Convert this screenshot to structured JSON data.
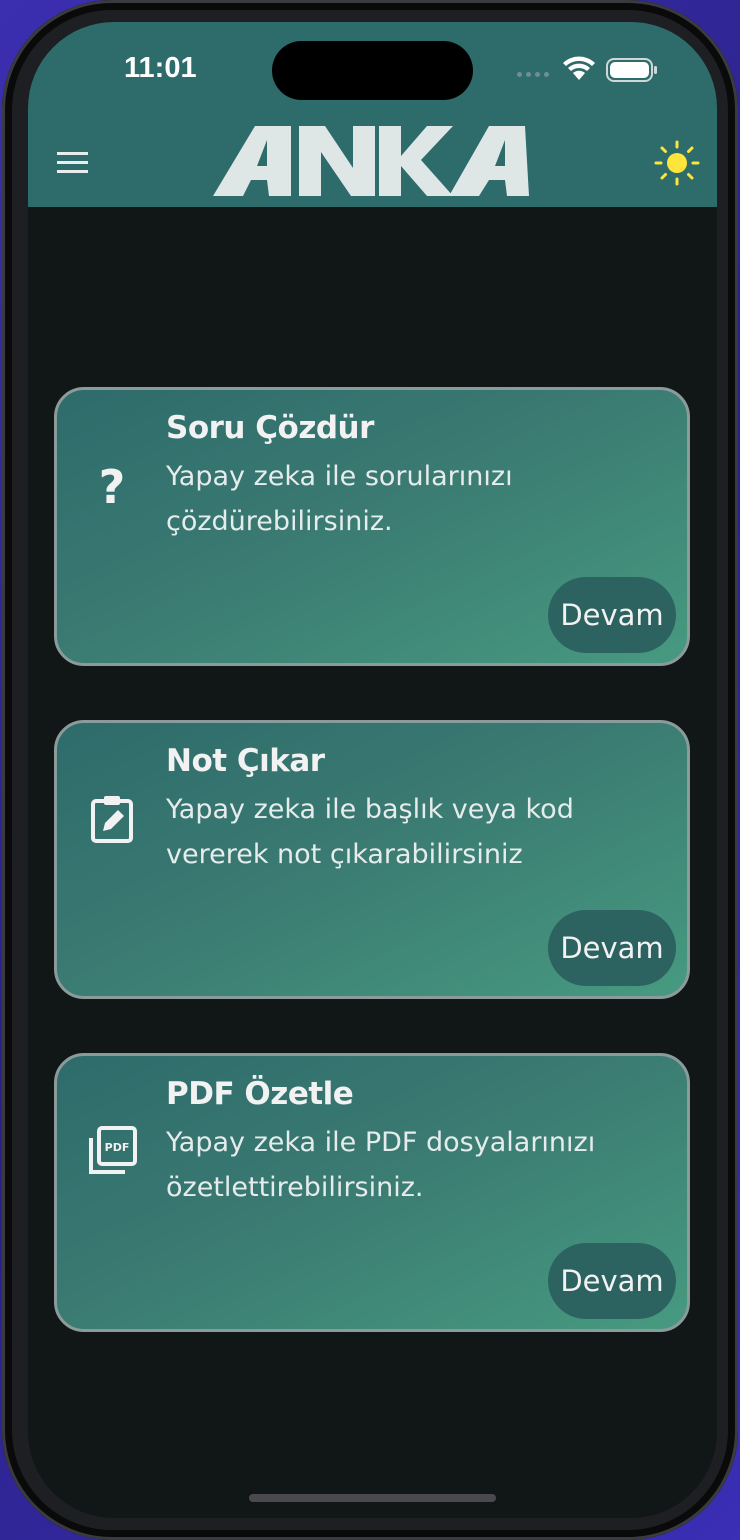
{
  "status_bar": {
    "time": "11:01"
  },
  "header": {
    "logo_text": "ANKA",
    "menu_icon": "hamburger-menu-icon",
    "theme_icon": "sun-icon",
    "colors": {
      "header_bg": "#2e6b6b",
      "logo": "#dfe6e6",
      "sun": "#ffe53b"
    }
  },
  "cards": [
    {
      "icon": "question-mark-icon",
      "icon_glyph": "?",
      "title": "Soru Çözdür",
      "description": "Yapay zeka ile sorularınızı çözdürebilirsiniz.",
      "button_label": "Devam"
    },
    {
      "icon": "clipboard-edit-icon",
      "title": "Not Çıkar",
      "description": "Yapay zeka ile başlık veya kod vererek not çıkarabilirsiniz",
      "button_label": "Devam"
    },
    {
      "icon": "pdf-stack-icon",
      "icon_text": "PDF",
      "title": "PDF Özetle",
      "description": "Yapay zeka ile PDF dosyalarınızı özetlettirebilirsiniz.",
      "button_label": "Devam"
    }
  ],
  "theme": {
    "background": "#111617",
    "card_border": "#8b9a9a",
    "button_bg": "#2c6361",
    "text": "#f2f2f2"
  }
}
